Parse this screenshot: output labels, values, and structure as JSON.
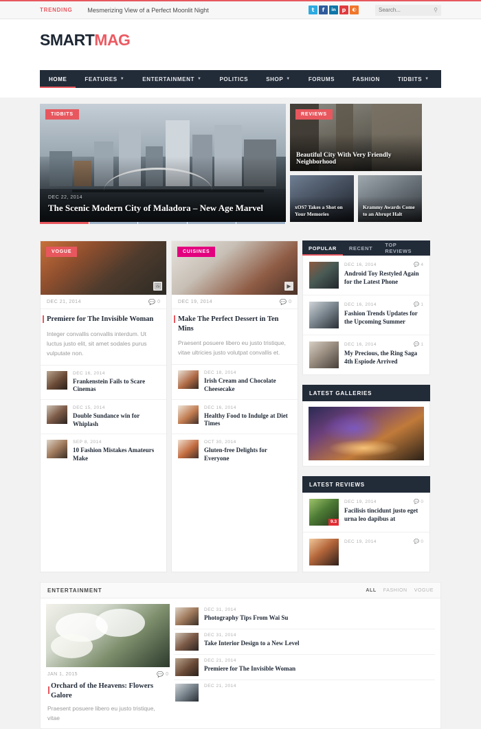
{
  "topbar": {
    "trending_label": "TRENDING",
    "trending_text": "Mesmerizing View of a Perfect Moonlit Night",
    "social": [
      {
        "name": "twitter-icon",
        "glyph": "t",
        "color": "#2daae1"
      },
      {
        "name": "facebook-icon",
        "glyph": "f",
        "color": "#2f5b9b"
      },
      {
        "name": "linkedin-icon",
        "glyph": "in",
        "color": "#0e76a8"
      },
      {
        "name": "pinterest-icon",
        "glyph": "p",
        "color": "#e03a3e"
      },
      {
        "name": "rss-icon",
        "glyph": "◔",
        "color": "#f0762b"
      }
    ],
    "search_placeholder": "Search...",
    "search_value": "",
    "search_icon": "search-icon"
  },
  "brand": {
    "part1": "SMART",
    "part2": "MAG",
    "color1": "#1d2733",
    "color2": "#ec5a62"
  },
  "nav": {
    "items": [
      {
        "label": "HOME",
        "caret": false,
        "active": true
      },
      {
        "label": "FEATURES",
        "caret": true,
        "active": false
      },
      {
        "label": "ENTERTAINMENT",
        "caret": true,
        "active": false
      },
      {
        "label": "POLITICS",
        "caret": false,
        "active": false
      },
      {
        "label": "SHOP",
        "caret": true,
        "active": false
      },
      {
        "label": "FORUMS",
        "caret": false,
        "active": false
      },
      {
        "label": "FASHION",
        "caret": false,
        "active": false
      },
      {
        "label": "TIDBITS",
        "caret": true,
        "active": false
      }
    ]
  },
  "featured": {
    "main": {
      "category": "TIDBITS",
      "date": "DEC 22, 2014",
      "title": "The Scenic Modern City of Maladora – New Age Marvel",
      "slides_total": 5,
      "slide_active": 1
    },
    "side_big": {
      "category": "REVIEWS",
      "title": "Beautiful City With Very Friendly Neighborhood"
    },
    "side_small": [
      {
        "title": "xOS7 Takes a Shot on Your Memories"
      },
      {
        "title": "Krammy Awards Come to an Abrupt Halt"
      }
    ]
  },
  "left_column": {
    "category": "VOGUE",
    "category_color": "#e8575e",
    "date": "DEC 21, 2014",
    "comments": "0",
    "title": "Premiere for The Invisible Woman",
    "excerpt": "Integer convallis convallis interdum. Ut luctus justo elit, sit amet sodales purus vulputate non.",
    "format_icon": "image-icon",
    "items": [
      {
        "date": "DEC 16, 2014",
        "title": "Frankenstein Fails to Scare Cinemas"
      },
      {
        "date": "DEC 15, 2014",
        "title": "Double Sundance win for Whiplash"
      },
      {
        "date": "SEP 8, 2014",
        "title": "10 Fashion Mistakes Amateurs Make"
      }
    ]
  },
  "mid_column": {
    "category": "CUISINES",
    "category_color": "#e3007e",
    "date": "DEC 19, 2014",
    "comments": "0",
    "title": "Make The Perfect Dessert in Ten Mins",
    "excerpt": "Praesent posuere libero eu justo tristique, vitae ultricies justo volutpat convallis et.",
    "format_icon": "video-icon",
    "items": [
      {
        "date": "DEC 18, 2014",
        "title": "Irish Cream and Chocolate Cheesecake"
      },
      {
        "date": "DEC 16, 2014",
        "title": "Healthy Food to Indulge at Diet Times"
      },
      {
        "date": "OCT 30, 2014",
        "title": "Gluten-free Delights for Everyone"
      }
    ]
  },
  "sidebar": {
    "tabs": [
      {
        "label": "POPULAR",
        "active": true
      },
      {
        "label": "RECENT",
        "active": false
      },
      {
        "label": "TOP REVIEWS",
        "active": false
      }
    ],
    "popular": [
      {
        "date": "DEC 16, 2014",
        "comments": "4",
        "title": "Android Toy Restyled Again for the Latest Phone"
      },
      {
        "date": "DEC 16, 2014",
        "comments": "1",
        "title": "Fashion Trends Updates for the Upcoming Summer"
      },
      {
        "date": "DEC 16, 2014",
        "comments": "1",
        "title": "My Precious, the Ring Saga 4th Espiode Arrived"
      }
    ],
    "galleries_title": "LATEST GALLERIES",
    "reviews_title": "LATEST REVIEWS",
    "reviews": [
      {
        "date": "DEC 19, 2014",
        "comments": "0",
        "title": "Facilisis tincidunt justo eget urna leo dapibus at",
        "score": "9.3"
      },
      {
        "date": "DEC 19, 2014",
        "comments": "0",
        "title": "",
        "score": ""
      }
    ]
  },
  "entertainment": {
    "title": "ENTERTAINMENT",
    "filters": [
      {
        "label": "ALL",
        "active": true
      },
      {
        "label": "FASHION",
        "active": false
      },
      {
        "label": "VOGUE",
        "active": false
      }
    ],
    "feature": {
      "date": "JAN 1, 2015",
      "comments": "0",
      "title": "Orchard of the Heavens: Flowers Galore",
      "excerpt": "Praesent posuere libero eu justo tristique, vitae"
    },
    "items": [
      {
        "date": "DEC 31, 2014",
        "title": "Photography Tips From Wai Su"
      },
      {
        "date": "DEC 31, 2014",
        "title": "Take Interior Design to a New Level"
      },
      {
        "date": "DEC 21, 2014",
        "title": "Premiere for The Invisible Woman"
      },
      {
        "date": "DEC 21, 2014",
        "title": ""
      }
    ]
  }
}
